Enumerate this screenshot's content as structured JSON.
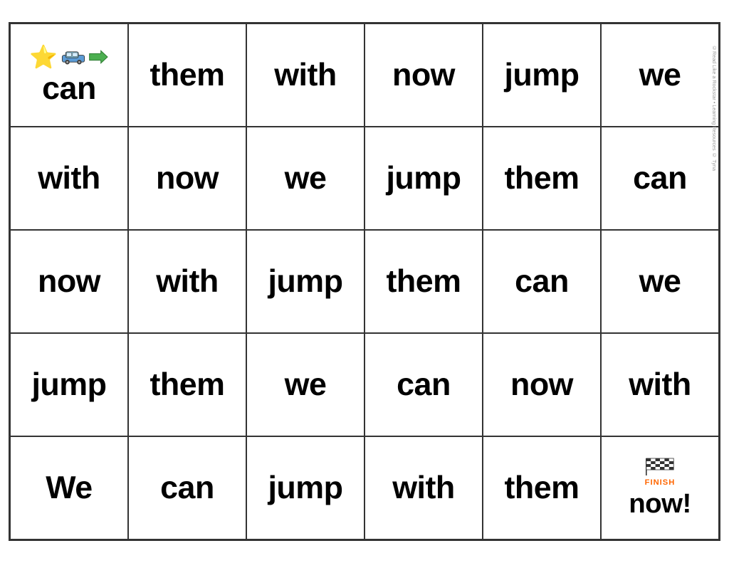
{
  "grid": {
    "rows": [
      [
        {
          "type": "header",
          "content": "icons"
        },
        {
          "type": "word",
          "text": "them"
        },
        {
          "type": "word",
          "text": "with"
        },
        {
          "type": "word",
          "text": "now"
        },
        {
          "type": "word",
          "text": "jump"
        },
        {
          "type": "word",
          "text": "we"
        }
      ],
      [
        {
          "type": "word",
          "text": "with"
        },
        {
          "type": "word",
          "text": "now"
        },
        {
          "type": "word",
          "text": "we"
        },
        {
          "type": "word",
          "text": "jump"
        },
        {
          "type": "word",
          "text": "them"
        },
        {
          "type": "word",
          "text": "can"
        }
      ],
      [
        {
          "type": "word",
          "text": "now"
        },
        {
          "type": "word",
          "text": "with"
        },
        {
          "type": "word",
          "text": "jump"
        },
        {
          "type": "word",
          "text": "them"
        },
        {
          "type": "word",
          "text": "can"
        },
        {
          "type": "word",
          "text": "we"
        }
      ],
      [
        {
          "type": "word",
          "text": "jump"
        },
        {
          "type": "word",
          "text": "them"
        },
        {
          "type": "word",
          "text": "we"
        },
        {
          "type": "word",
          "text": "can"
        },
        {
          "type": "word",
          "text": "now"
        },
        {
          "type": "word",
          "text": "with"
        }
      ],
      [
        {
          "type": "word",
          "text": "We"
        },
        {
          "type": "word",
          "text": "can"
        },
        {
          "type": "word",
          "text": "jump"
        },
        {
          "type": "word",
          "text": "with"
        },
        {
          "type": "word",
          "text": "them"
        },
        {
          "type": "finish",
          "text": "now!"
        }
      ]
    ],
    "first_row_first_cell": "can",
    "watermark": "©Read Like a Rockstar • Learning Resources © Tyna"
  }
}
